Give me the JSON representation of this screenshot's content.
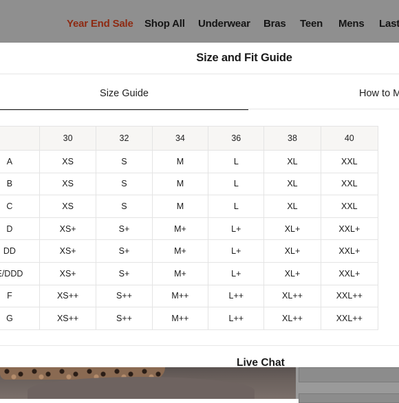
{
  "nav": {
    "items": [
      {
        "label": "Year End Sale",
        "accent": "#8e2a12"
      },
      {
        "label": "Shop All"
      },
      {
        "label": "Underwear"
      },
      {
        "label": "Bras"
      },
      {
        "label": "Teen"
      },
      {
        "label": "Mens"
      },
      {
        "label": "Last"
      }
    ]
  },
  "modal": {
    "title": "Size and Fit Guide",
    "tabs": [
      {
        "label": "Size Guide",
        "active": true
      },
      {
        "label": "How to M",
        "active": false
      }
    ]
  },
  "size_table": {
    "band_sizes": [
      "30",
      "32",
      "34",
      "36",
      "38",
      "40"
    ],
    "rows": [
      {
        "cup": "A",
        "sizes": [
          "XS",
          "S",
          "M",
          "L",
          "XL",
          "XXL"
        ]
      },
      {
        "cup": "B",
        "sizes": [
          "XS",
          "S",
          "M",
          "L",
          "XL",
          "XXL"
        ]
      },
      {
        "cup": "C",
        "sizes": [
          "XS",
          "S",
          "M",
          "L",
          "XL",
          "XXL"
        ]
      },
      {
        "cup": "D",
        "sizes": [
          "XS+",
          "S+",
          "M+",
          "L+",
          "XL+",
          "XXL+"
        ]
      },
      {
        "cup": "DD",
        "sizes": [
          "XS+",
          "S+",
          "M+",
          "L+",
          "XL+",
          "XXL+"
        ]
      },
      {
        "cup": "E/DDD",
        "sizes": [
          "XS+",
          "S+",
          "M+",
          "L+",
          "XL+",
          "XXL+"
        ]
      },
      {
        "cup": "F",
        "sizes": [
          "XS++",
          "S++",
          "M++",
          "L++",
          "XL++",
          "XXL++"
        ]
      },
      {
        "cup": "G",
        "sizes": [
          "XS++",
          "S++",
          "M++",
          "L++",
          "XL++",
          "XXL++"
        ]
      }
    ]
  },
  "live_chat": {
    "label": "Live Chat"
  }
}
